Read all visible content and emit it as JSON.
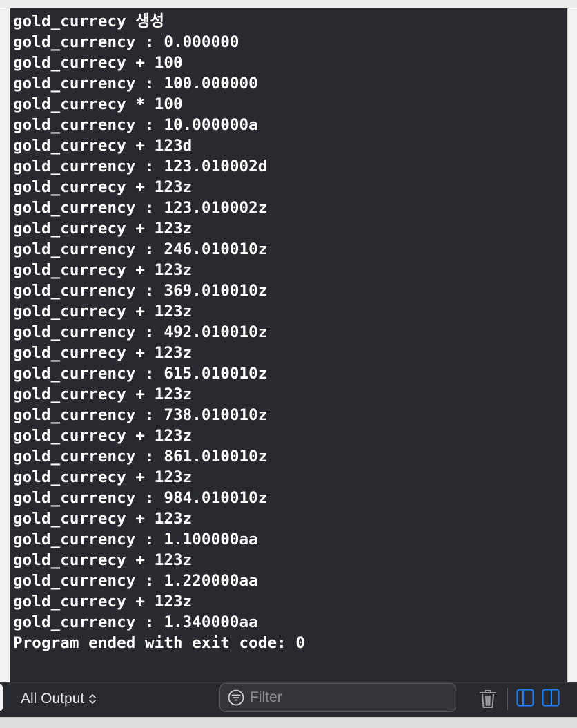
{
  "console": {
    "lines": [
      "gold_currecy 생성",
      "gold_currency : 0.000000",
      "gold_currecy + 100",
      "gold_currency : 100.000000",
      "gold_currecy * 100",
      "gold_currency : 10.000000a",
      "gold_currecy + 123d",
      "gold_currency : 123.010002d",
      "gold_currecy + 123z",
      "gold_currency : 123.010002z",
      "gold_currecy + 123z",
      "gold_currency : 246.010010z",
      "gold_currecy + 123z",
      "gold_currency : 369.010010z",
      "gold_currecy + 123z",
      "gold_currency : 492.010010z",
      "gold_currecy + 123z",
      "gold_currency : 615.010010z",
      "gold_currecy + 123z",
      "gold_currency : 738.010010z",
      "gold_currecy + 123z",
      "gold_currency : 861.010010z",
      "gold_currecy + 123z",
      "gold_currency : 984.010010z",
      "gold_currecy + 123z",
      "gold_currency : 1.100000aa",
      "gold_currecy + 123z",
      "gold_currency : 1.220000aa",
      "gold_currecy + 123z",
      "gold_currency : 1.340000aa",
      "Program ended with exit code: 0"
    ]
  },
  "toolbar": {
    "output_selector_label": "All Output",
    "filter_placeholder": "Filter",
    "filter_value": "",
    "icons": {
      "selector": "chevron-up-down-icon",
      "filter": "filter-icon",
      "trash": "trash-icon",
      "panel_left": "sidebar-left-icon",
      "panel_right": "sidebar-right-icon"
    }
  },
  "colors": {
    "console_background": "#292a30",
    "console_text": "#ffffff",
    "accent": "#1a82ff"
  }
}
